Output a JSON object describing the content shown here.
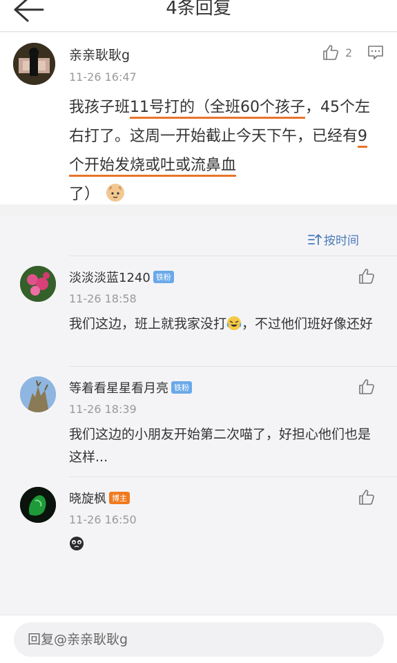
{
  "header": {
    "title": "4条回复"
  },
  "main_comment": {
    "author": "亲亲耿耿g",
    "time": "11-26 16:47",
    "likes": "2",
    "text_parts": {
      "p1": "我孩子班",
      "p2": "11号打的（全班60个孩子",
      "p3": "，45个左右打了。这周一开始截止今天下午，已经有",
      "p4": "9个开始发烧或吐或流鼻血",
      "p5": "了）"
    },
    "emoji": "cat-face-emoji"
  },
  "sort": {
    "label": "按时间"
  },
  "replies": [
    {
      "author": "淡淡淡蓝1240",
      "badge": "铁粉",
      "time": "11-26 18:58",
      "text_a": "我们这边，班上就我家没打",
      "text_b": "，不过他们班好像还好"
    },
    {
      "author": "等着看星星看月亮",
      "badge": "铁粉",
      "time": "11-26 18:39",
      "text": "我们这边的小朋友开始第二次喵了，好担心他们也是这样..."
    },
    {
      "author": "晓旋枫",
      "badge": "博主",
      "time": "11-26 16:50",
      "text": ""
    }
  ],
  "reply_box": {
    "placeholder": "回复@亲亲耿耿g"
  },
  "colors": {
    "accent_underline": "#e8742a",
    "link_blue": "#4a7ab8",
    "fan_badge": "#6aa9e9",
    "host_badge": "#f07a1f"
  }
}
